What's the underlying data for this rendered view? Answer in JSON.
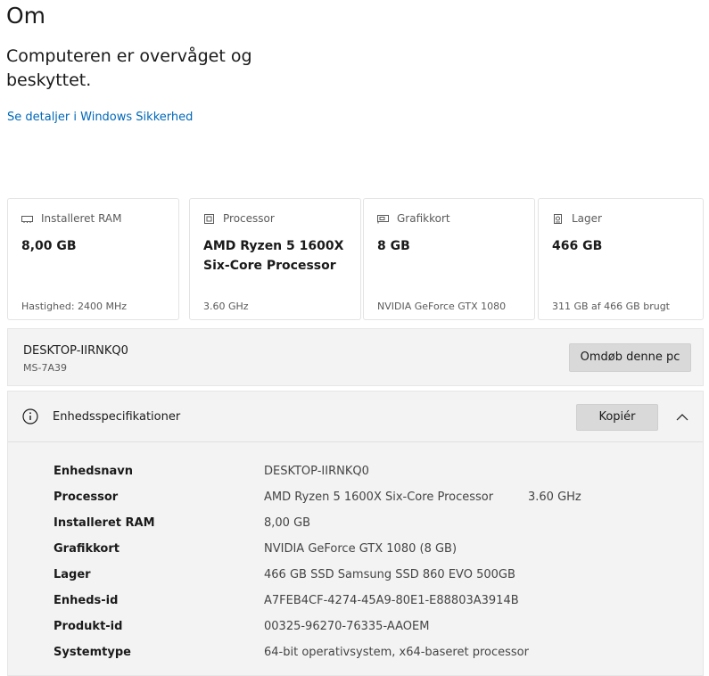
{
  "header": {
    "title": "Om",
    "status": "Computeren er overvåget og beskyttet.",
    "security_link": "Se detaljer i Windows Sikkerhed"
  },
  "cards": [
    {
      "icon": "ram-icon",
      "label": "Installeret RAM",
      "value": "8,00 GB",
      "foot": "Hastighed: 2400 MHz"
    },
    {
      "icon": "cpu-icon",
      "label": "Processor",
      "value": "AMD Ryzen 5 1600X Six-Core Processor",
      "foot": "3.60 GHz"
    },
    {
      "icon": "gpu-icon",
      "label": "Grafikkort",
      "value": "8 GB",
      "foot": "NVIDIA GeForce GTX 1080"
    },
    {
      "icon": "storage-icon",
      "label": "Lager",
      "value": "466 GB",
      "foot": "311 GB af 466 GB brugt"
    }
  ],
  "pc": {
    "name": "DESKTOP-IIRNKQ0",
    "model": "MS-7A39",
    "rename_label": "Omdøb denne pc"
  },
  "specs": {
    "title": "Enhedsspecifikationer",
    "copy_label": "Kopiér",
    "rows": [
      {
        "label": "Enhedsnavn",
        "value": "DESKTOP-IIRNKQ0",
        "extra": ""
      },
      {
        "label": "Processor",
        "value": "AMD Ryzen 5 1600X Six-Core Processor",
        "extra": "3.60 GHz"
      },
      {
        "label": "Installeret RAM",
        "value": "8,00 GB",
        "extra": ""
      },
      {
        "label": "Grafikkort",
        "value": "NVIDIA GeForce GTX 1080 (8 GB)",
        "extra": ""
      },
      {
        "label": "Lager",
        "value": "466 GB SSD Samsung SSD 860 EVO 500GB",
        "extra": ""
      },
      {
        "label": "Enheds-id",
        "value": "A7FEB4CF-4274-45A9-80E1-E88803A3914B",
        "extra": ""
      },
      {
        "label": "Produkt-id",
        "value": "00325-96270-76335-AAOEM",
        "extra": ""
      },
      {
        "label": "Systemtype",
        "value": "64-bit operativsystem, x64-baseret processor",
        "extra": ""
      }
    ]
  },
  "colors": {
    "link": "#0067b8",
    "panel_bg": "#f3f3f3",
    "button_bg": "#d9d9d9"
  }
}
